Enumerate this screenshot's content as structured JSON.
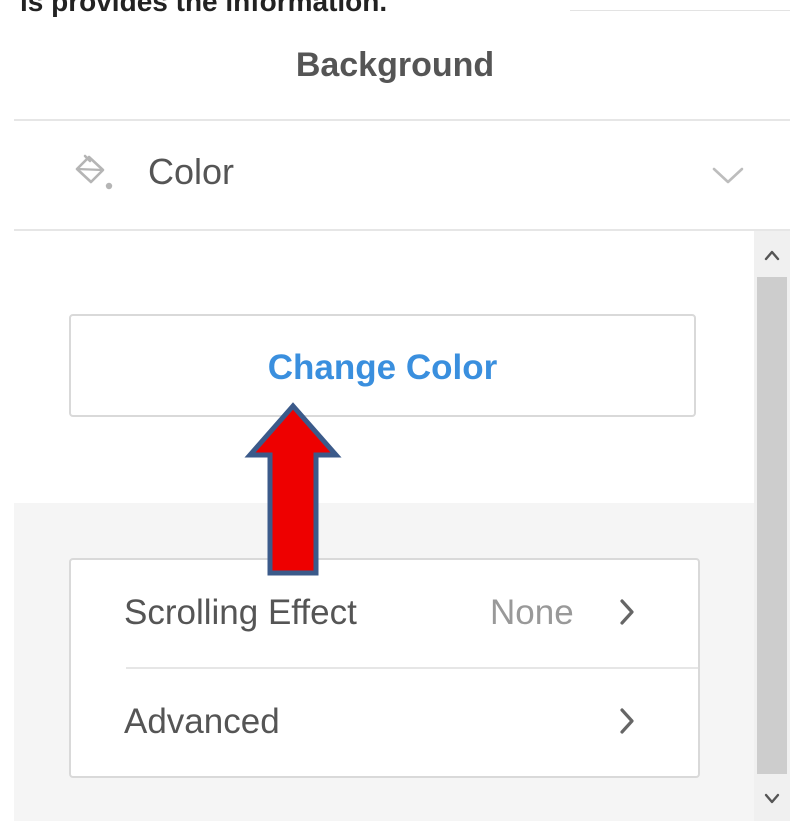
{
  "top_clipped_text": "is provides the information.",
  "panel": {
    "title": "Background"
  },
  "section": {
    "label": "Color",
    "icon": "paint-bucket-icon",
    "toggle_icon": "chevron-down-icon"
  },
  "change_color": {
    "label": "Change Color",
    "color": "#3a8fde"
  },
  "options": [
    {
      "label": "Scrolling Effect",
      "value": "None",
      "icon": "chevron-right-icon"
    },
    {
      "label": "Advanced",
      "value": "",
      "icon": "chevron-right-icon"
    }
  ],
  "annotation": {
    "icon": "red-arrow-icon",
    "fill": "#ee0000",
    "stroke": "#3b5a8a"
  }
}
